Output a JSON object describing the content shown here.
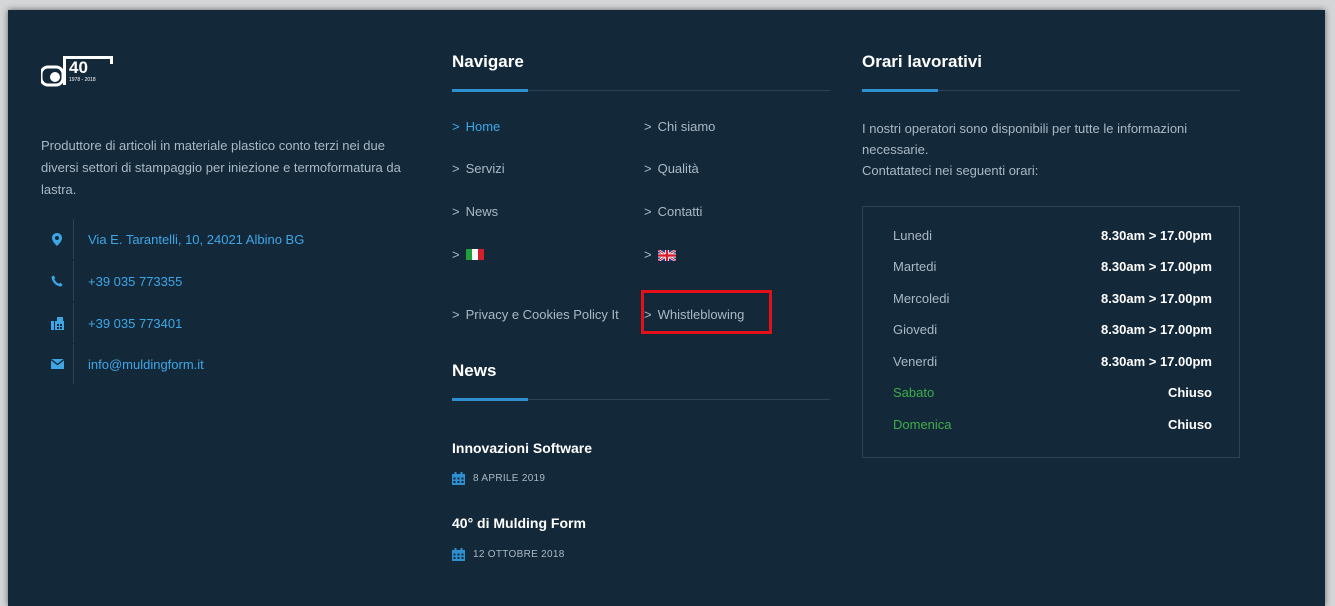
{
  "logo": {
    "number": "40",
    "years": "1978 - 2018"
  },
  "about": {
    "description": "Produttore di articoli in materiale plastico conto terzi nei due diversi settori di stampaggio per iniezione e termoformatura da lastra.",
    "contacts": [
      {
        "icon": "map-pin-icon",
        "text": "Via E. Tarantelli, 10, 24021 Albino BG"
      },
      {
        "icon": "phone-icon",
        "text": "+39 035 773355"
      },
      {
        "icon": "fax-icon",
        "text": "+39 035 773401"
      },
      {
        "icon": "envelope-icon",
        "text": "info@muldingform.it"
      }
    ]
  },
  "nav": {
    "heading": "Navigare",
    "chevron": ">",
    "left": [
      {
        "label": "Home",
        "active": true
      },
      {
        "label": "Servizi"
      },
      {
        "label": "News"
      },
      {
        "label": "",
        "icon": "italy-flag-icon"
      },
      {
        "label": "Privacy e Cookies Policy It"
      }
    ],
    "right": [
      {
        "label": "Chi siamo"
      },
      {
        "label": "Qualità"
      },
      {
        "label": "Contatti"
      },
      {
        "label": "",
        "icon": "uk-flag-icon"
      },
      {
        "label": "Whistleblowing"
      }
    ]
  },
  "news": {
    "heading": "News",
    "items": [
      {
        "title": "Innovazioni Software",
        "date": "8 APRILE 2019"
      },
      {
        "title": "40° di Mulding Form",
        "date": "12 OTTOBRE 2018"
      }
    ]
  },
  "hours": {
    "heading": "Orari lavorativi",
    "intro_line1": "I nostri operatori sono disponibili per tutte le informazioni",
    "intro_line2": "necessarie.",
    "intro_line3": "Contattateci nei seguenti orari:",
    "rows": [
      {
        "day": "Lunedi",
        "time": "8.30am > 17.00pm"
      },
      {
        "day": "Martedi",
        "time": "8.30am > 17.00pm"
      },
      {
        "day": "Mercoledi",
        "time": "8.30am > 17.00pm"
      },
      {
        "day": "Giovedi",
        "time": "8.30am > 17.00pm"
      },
      {
        "day": "Venerdi",
        "time": "8.30am > 17.00pm"
      },
      {
        "day": "Sabato",
        "time": "Chiuso",
        "weekend": true
      },
      {
        "day": "Domenica",
        "time": "Chiuso",
        "weekend": true
      }
    ]
  },
  "colors": {
    "background": "#13293a",
    "accent": "#3fa6e6",
    "weekend": "#3fae49",
    "highlight": "#e3101a"
  }
}
